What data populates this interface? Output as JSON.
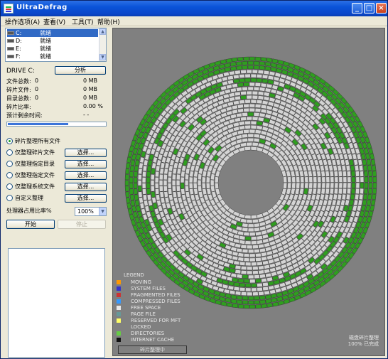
{
  "window": {
    "title": "UltraDefrag",
    "controls": [
      "_",
      "□",
      "×"
    ]
  },
  "menu": [
    {
      "label": "操作选项(A)"
    },
    {
      "label": "查看(V)"
    },
    {
      "label": "工具(T)"
    },
    {
      "label": "帮助(H)"
    }
  ],
  "drives": [
    {
      "letter": "C:",
      "status": "就绪",
      "selected": true
    },
    {
      "letter": "D:",
      "status": "就绪",
      "selected": false
    },
    {
      "letter": "E:",
      "status": "就绪",
      "selected": false
    },
    {
      "letter": "F:",
      "status": "就绪",
      "selected": false
    }
  ],
  "drive_section": {
    "label": "DRIVE C:",
    "button": "分析"
  },
  "stats": [
    {
      "label": "文件总数:",
      "count": "0",
      "value": "0 MB"
    },
    {
      "label": "碎片文件:",
      "count": "0",
      "value": "0 MB"
    },
    {
      "label": "目录总数:",
      "count": "0",
      "value": "0 MB"
    },
    {
      "label": "碎片比率:",
      "count": "",
      "value": "0.00 %"
    },
    {
      "label": "预计剩余时间:",
      "count": "",
      "value": "- -"
    }
  ],
  "progress": {
    "fraction": 0.62
  },
  "options": [
    {
      "label": "碎片整理所有文件",
      "checked": true,
      "button": ""
    },
    {
      "label": "仅整理碎片文件",
      "checked": false,
      "button": "选择..."
    },
    {
      "label": "仅整理指定目录",
      "checked": false,
      "button": "选择..."
    },
    {
      "label": "仅整理指定文件",
      "checked": false,
      "button": "选择..."
    },
    {
      "label": "仅整理系统文件",
      "checked": false,
      "button": "选择..."
    },
    {
      "label": "自定义整理",
      "checked": false,
      "button": "选择..."
    }
  ],
  "limit": {
    "label": "处理器占用比率%",
    "value": "100%"
  },
  "actions": {
    "start": "开始",
    "stop": "停止"
  },
  "legend": {
    "title": "LEGEND",
    "items": [
      {
        "label": "MOVING",
        "color": "#ff9900"
      },
      {
        "label": "SYSTEM FILES",
        "color": "#3333cc"
      },
      {
        "label": "FRAGMENTED FILES",
        "color": "#cc3333"
      },
      {
        "label": "COMPRESSED FILES",
        "color": "#3399ff"
      },
      {
        "label": "FREE SPACE",
        "color": "#e8e8e8"
      },
      {
        "label": "PAGE FILE",
        "color": "#669999"
      },
      {
        "label": "RESERVED FOR MFT",
        "color": "#ffff66"
      },
      {
        "label": "LOCKED",
        "color": "#808080"
      },
      {
        "label": "DIRECTORIES",
        "color": "#66cc44"
      },
      {
        "label": "INTERNET CACHE",
        "color": "#111111"
      }
    ],
    "status_box": "碎片整理中"
  },
  "corner": {
    "line1": "磁盘碎片整理",
    "line2": "100% 已完成"
  },
  "colors": {
    "map_bg": "#808080",
    "outer_ring": "#2f9e1f",
    "inner_band": "#d4d4d4",
    "accent": "#316ac5"
  }
}
